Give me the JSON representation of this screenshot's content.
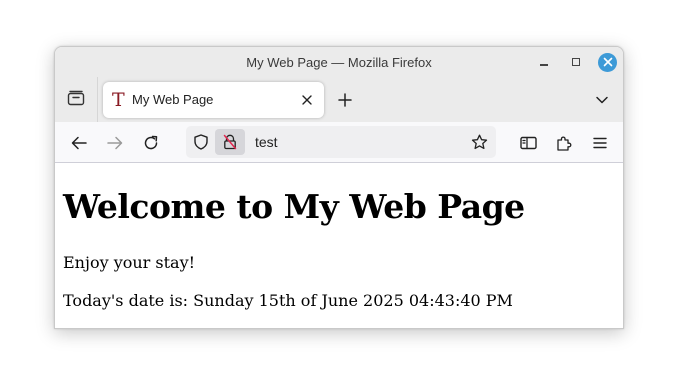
{
  "window": {
    "title": "My Web Page — Mozilla Firefox",
    "controls": [
      "minimize-icon",
      "maximize-icon",
      "close-icon"
    ],
    "accent_color": "#3d9ad7"
  },
  "tabs": [
    {
      "label": "My Web Page",
      "favicon": "T",
      "active": true
    }
  ],
  "toolbar": {
    "url": "test",
    "buttons": [
      "back-icon",
      "forward-icon",
      "reload-icon",
      "sidebar-icon",
      "extensions-icon",
      "menu-icon"
    ]
  },
  "page": {
    "heading": "Welcome to My Web Page",
    "paragraph": "Enjoy your stay!",
    "date_line": "Today's date is: Sunday 15th of June 2025 04:43:40 PM"
  }
}
